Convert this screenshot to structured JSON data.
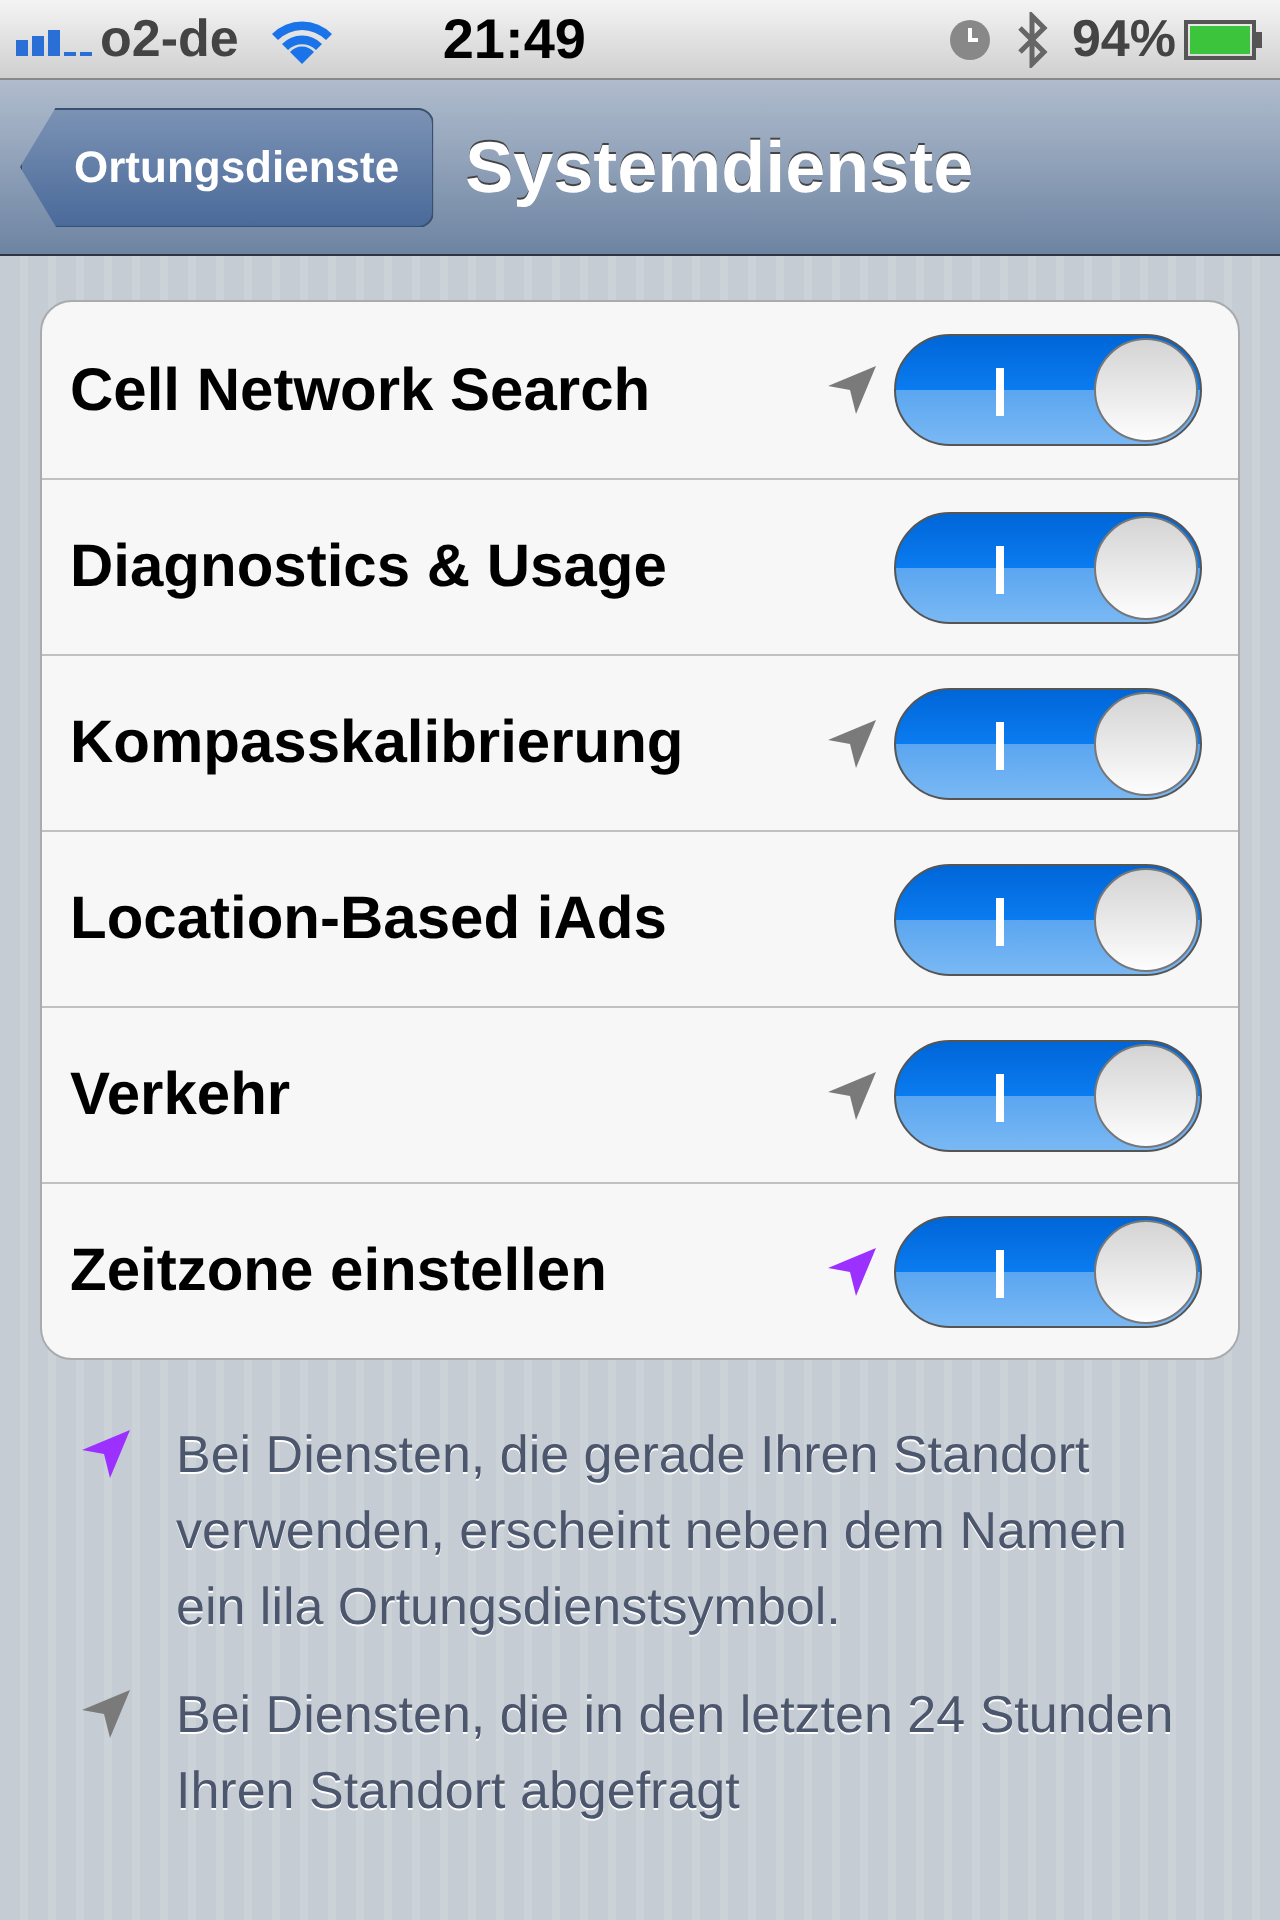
{
  "status_bar": {
    "carrier": "o2-de",
    "time": "21:49",
    "battery": "94%"
  },
  "nav_bar": {
    "back": "Ortungsdienste",
    "title": "Systemdienste"
  },
  "rows": [
    {
      "label": "Cell Network Search",
      "color": "#7a7a7a",
      "on": true
    },
    {
      "label": "Diagnostics & Usage",
      "on": true
    },
    {
      "label": "Kompasskalibrierung",
      "color": "#7a7a7a",
      "on": true
    },
    {
      "label": "Location-Based iAds",
      "on": true
    },
    {
      "label": "Verkehr",
      "color": "#7a7a7a",
      "on": true
    },
    {
      "label": "Zeitzone einstellen",
      "color": "#9b30ff",
      "on": true
    }
  ],
  "footnotes": [
    {
      "color": "#9b30ff",
      "text": "Bei Diensten, die gerade Ihren Standort verwenden, erscheint neben dem Namen ein lila Ortungsdienstsymbol."
    },
    {
      "color": "#7a7a7a",
      "text": "Bei Diensten, die in den letzten 24 Stunden Ihren Standort abgefragt"
    }
  ]
}
